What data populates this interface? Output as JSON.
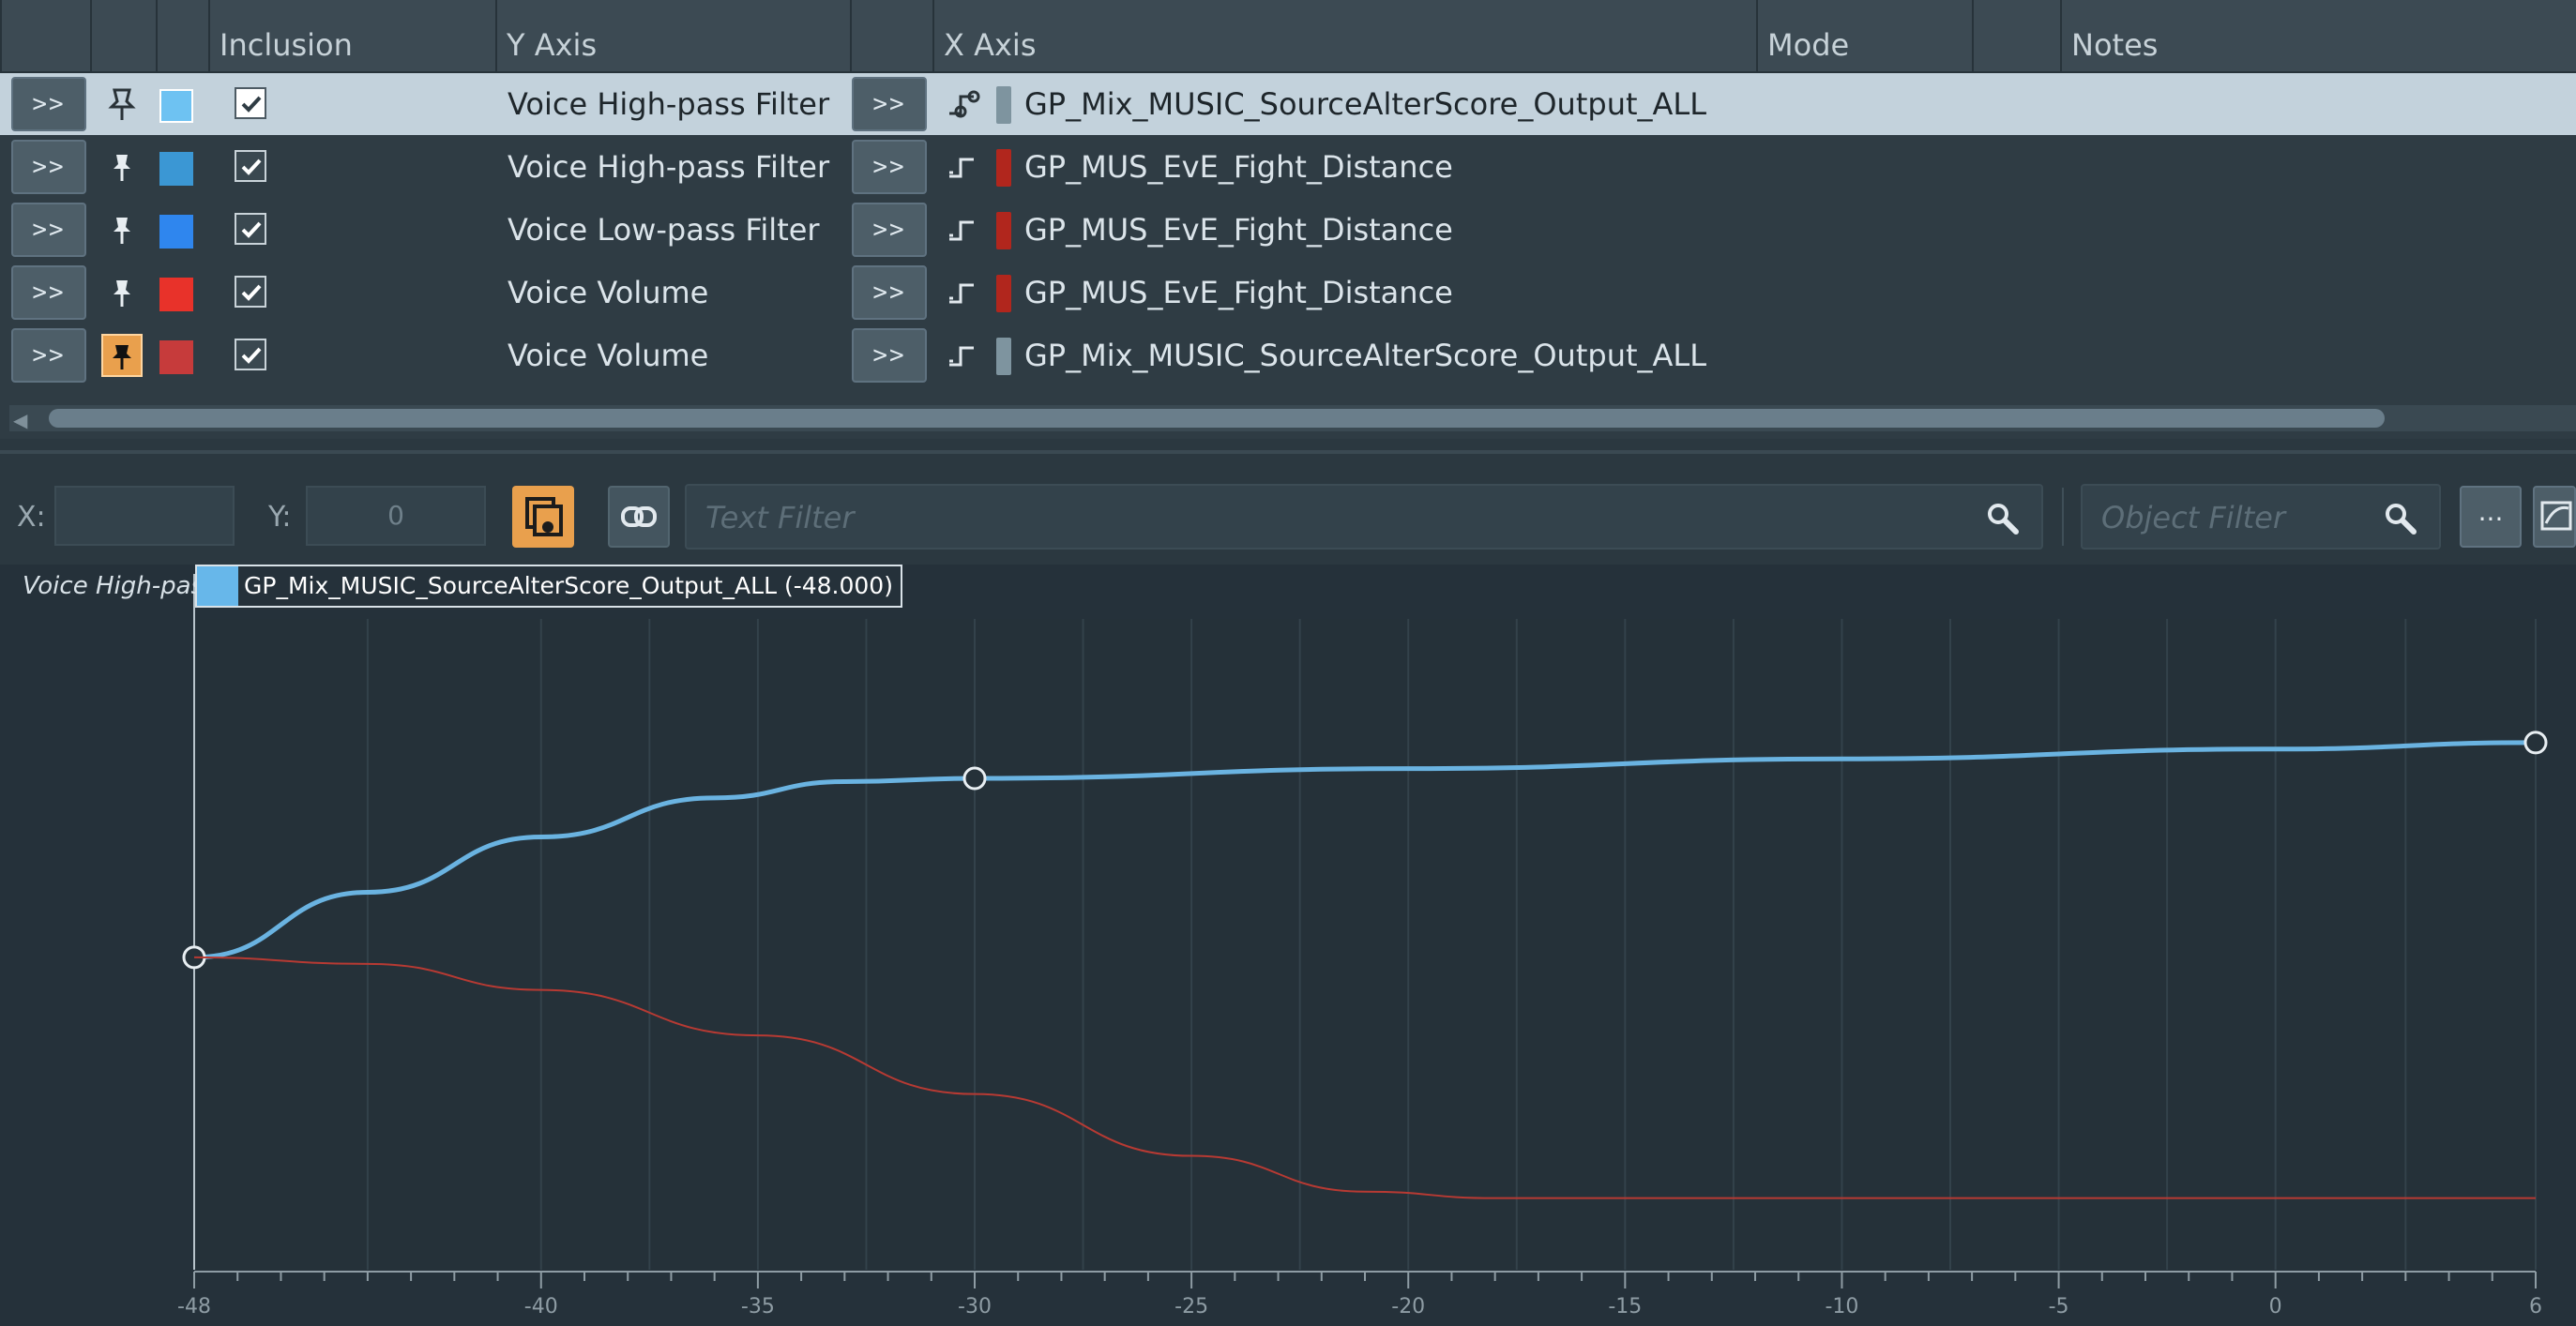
{
  "table": {
    "columns": {
      "inclusion": "Inclusion",
      "y_axis": "Y Axis",
      "x_axis": "X Axis",
      "mode": "Mode",
      "notes": "Notes"
    },
    "go_label": ">>",
    "rows": [
      {
        "y_axis": "Voice High-pass Filter",
        "x_axis": "GP_Mix_MUSIC_SourceAlterScore_Output_ALL",
        "color": "#6ec2f2",
        "source_color": "#7e949f",
        "pin": "pin-outline-icon",
        "included": true,
        "selected": true
      },
      {
        "y_axis": "Voice High-pass Filter",
        "x_axis": "GP_MUS_EvE_Fight_Distance",
        "color": "#3b97d4",
        "source_color": "#b1261d",
        "pin": "pin-icon",
        "included": true,
        "selected": false
      },
      {
        "y_axis": "Voice Low-pass Filter",
        "x_axis": "GP_MUS_EvE_Fight_Distance",
        "color": "#2f86ee",
        "source_color": "#b1261d",
        "pin": "pin-icon",
        "included": true,
        "selected": false
      },
      {
        "y_axis": "Voice Volume",
        "x_axis": "GP_MUS_EvE_Fight_Distance",
        "color": "#e8322a",
        "source_color": "#b1261d",
        "pin": "pin-icon",
        "included": true,
        "selected": false
      },
      {
        "y_axis": "Voice Volume",
        "x_axis": "GP_Mix_MUSIC_SourceAlterScore_Output_ALL",
        "color": "#c63b3b",
        "source_color": "#7e949f",
        "pin": "pin-active-icon",
        "included": true,
        "selected": false
      }
    ]
  },
  "toolbar": {
    "x_label": "X:",
    "x_value": "",
    "y_label": "Y:",
    "y_value": "0",
    "text_filter_placeholder": "Text Filter",
    "object_filter_placeholder": "Object Filter",
    "more_label": "..."
  },
  "graph": {
    "title": "Voice High-pas",
    "tooltip": "GP_Mix_MUSIC_SourceAlterScore_Output_ALL (-48.000)",
    "tooltip_color": "#67b7ea"
  },
  "chart_data": {
    "type": "line",
    "x_ticks": [
      -48,
      -40,
      -35,
      -30,
      -25,
      -20,
      -15,
      -10,
      -5,
      0,
      6
    ],
    "xlim": [
      -48,
      6
    ],
    "ylim": [
      0,
      1
    ],
    "grid": true,
    "series": [
      {
        "color": "#6ab3e1",
        "points": [
          [
            -48,
            0.48
          ],
          [
            -44,
            0.58
          ],
          [
            -40,
            0.665
          ],
          [
            -36,
            0.725
          ],
          [
            -33,
            0.75
          ],
          [
            -30,
            0.755
          ],
          [
            -20,
            0.77
          ],
          [
            -10,
            0.785
          ],
          [
            0,
            0.8
          ],
          [
            6,
            0.81
          ]
        ],
        "control_points": [
          [
            -48,
            0.48
          ],
          [
            -30,
            0.755
          ],
          [
            6,
            0.81
          ]
        ]
      },
      {
        "color": "#b73a33",
        "points": [
          [
            -48,
            0.48
          ],
          [
            -44,
            0.47
          ],
          [
            -40,
            0.43
          ],
          [
            -35,
            0.36
          ],
          [
            -30,
            0.27
          ],
          [
            -25,
            0.175
          ],
          [
            -21,
            0.12
          ],
          [
            -18,
            0.11
          ],
          [
            -10,
            0.11
          ],
          [
            0,
            0.11
          ],
          [
            6,
            0.11
          ]
        ],
        "control_points": []
      }
    ]
  }
}
